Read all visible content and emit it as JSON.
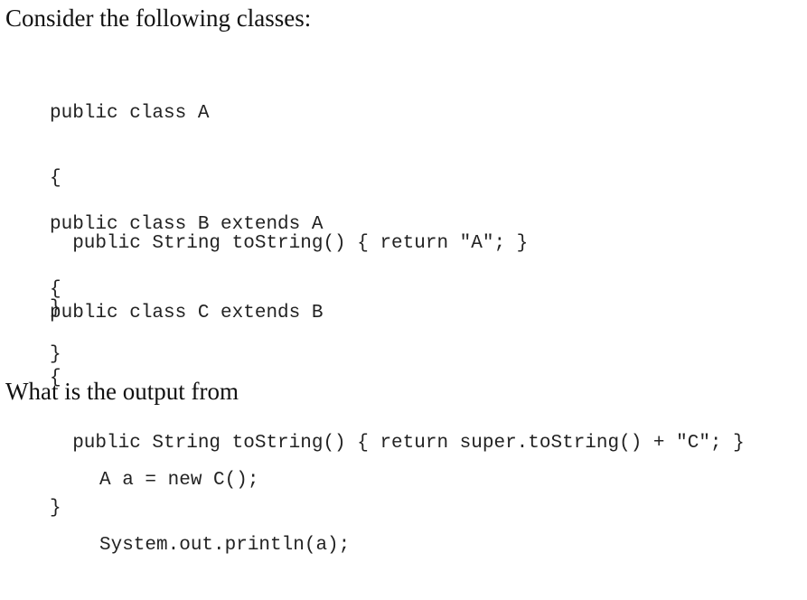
{
  "intro": {
    "text": "Consider the following classes:"
  },
  "class_a": {
    "lines": [
      "public class A",
      "{",
      "  public String toString() { return \"A\"; }",
      "}"
    ]
  },
  "class_b": {
    "lines": [
      "public class B extends A",
      "{",
      "}"
    ]
  },
  "class_c": {
    "lines": [
      "public class C extends B",
      "{",
      "  public String toString() { return super.toString() + \"C\"; }",
      "}"
    ]
  },
  "question": {
    "text": "What is the output from"
  },
  "snippet": {
    "lines": [
      "A a = new C();",
      "System.out.println(a);"
    ]
  }
}
